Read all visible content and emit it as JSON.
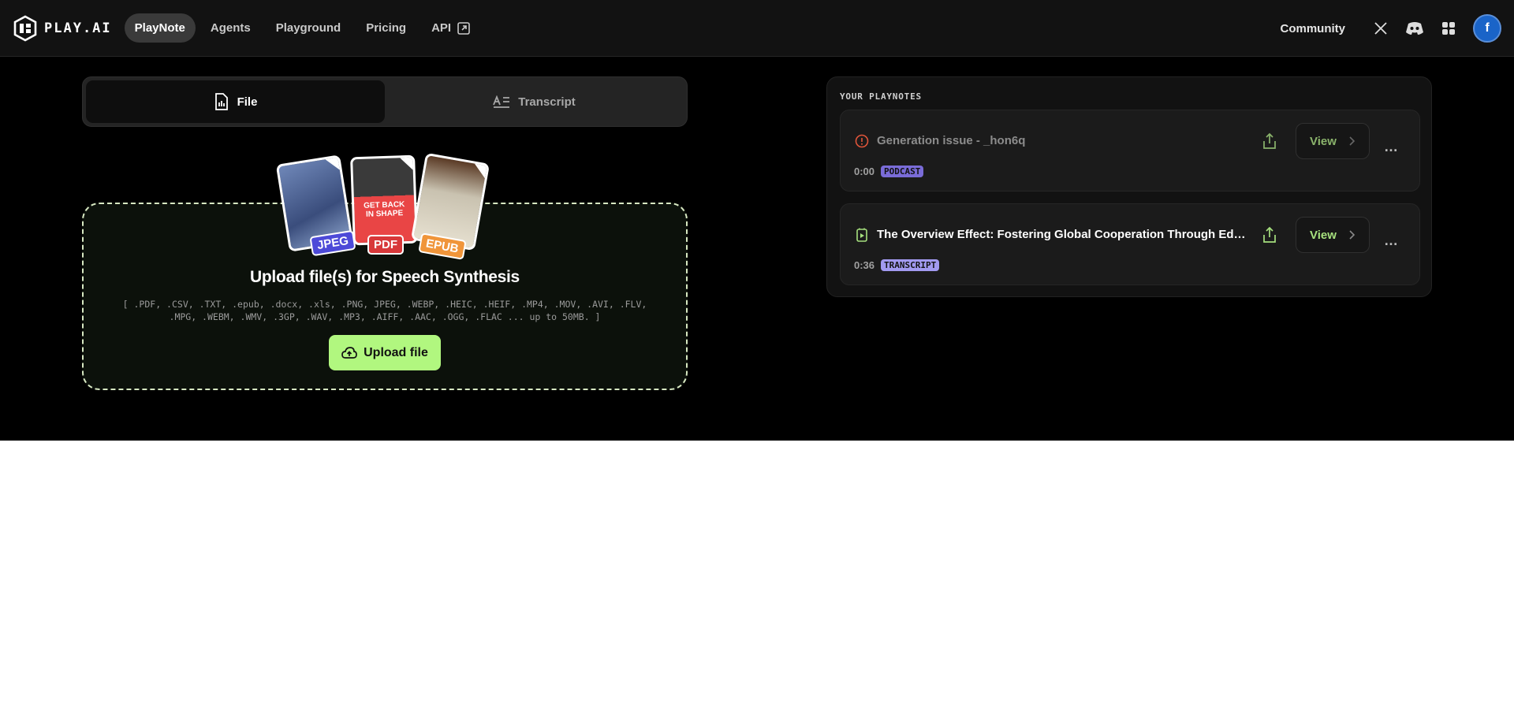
{
  "brand": {
    "name": "PLAY.AI"
  },
  "nav": {
    "links": [
      {
        "label": "PlayNote",
        "active": true
      },
      {
        "label": "Agents",
        "active": false
      },
      {
        "label": "Playground",
        "active": false
      },
      {
        "label": "Pricing",
        "active": false
      },
      {
        "label": "API",
        "active": false
      }
    ],
    "community_label": "Community",
    "avatar_letter": "f"
  },
  "input_tabs": {
    "file_label": "File",
    "transcript_label": "Transcript",
    "active": "File"
  },
  "upload": {
    "file_badges": {
      "jpeg": "JPEG",
      "pdf": "PDF",
      "epub": "EPUB"
    },
    "pdf_cover_text": "GET BACK IN SHAPE",
    "title": "Upload file(s) for Speech Synthesis",
    "formats_line1": "[ .PDF, .CSV, .TXT, .epub, .docx, .xls, .PNG, JPEG, .WEBP, .HEIC, .HEIF, .MP4, .MOV, .AVI, .FLV,",
    "formats_line2": ".MPG, .WEBM, .WMV, .3GP, .WAV, .MP3, .AIFF, .AAC, .OGG, .FLAC ... up to 50MB. ]",
    "button_label": "Upload file"
  },
  "playnotes": {
    "heading": "YOUR PLAYNOTES",
    "items": [
      {
        "title": "Generation issue - _hon6q",
        "duration": "0:00",
        "type": "PODCAST",
        "status": "error",
        "view_label": "View"
      },
      {
        "title": "The Overview Effect: Fostering Global Cooperation Through Educa...",
        "duration": "0:36",
        "type": "TRANSCRIPT",
        "status": "ready",
        "view_label": "View"
      }
    ]
  },
  "colors": {
    "accent_green": "#b1f77f",
    "error_red": "#e0553a",
    "podcast_pill": "#7a6cd8",
    "transcript_pill": "#a29af0",
    "avatar_blue": "#1a64c8"
  }
}
